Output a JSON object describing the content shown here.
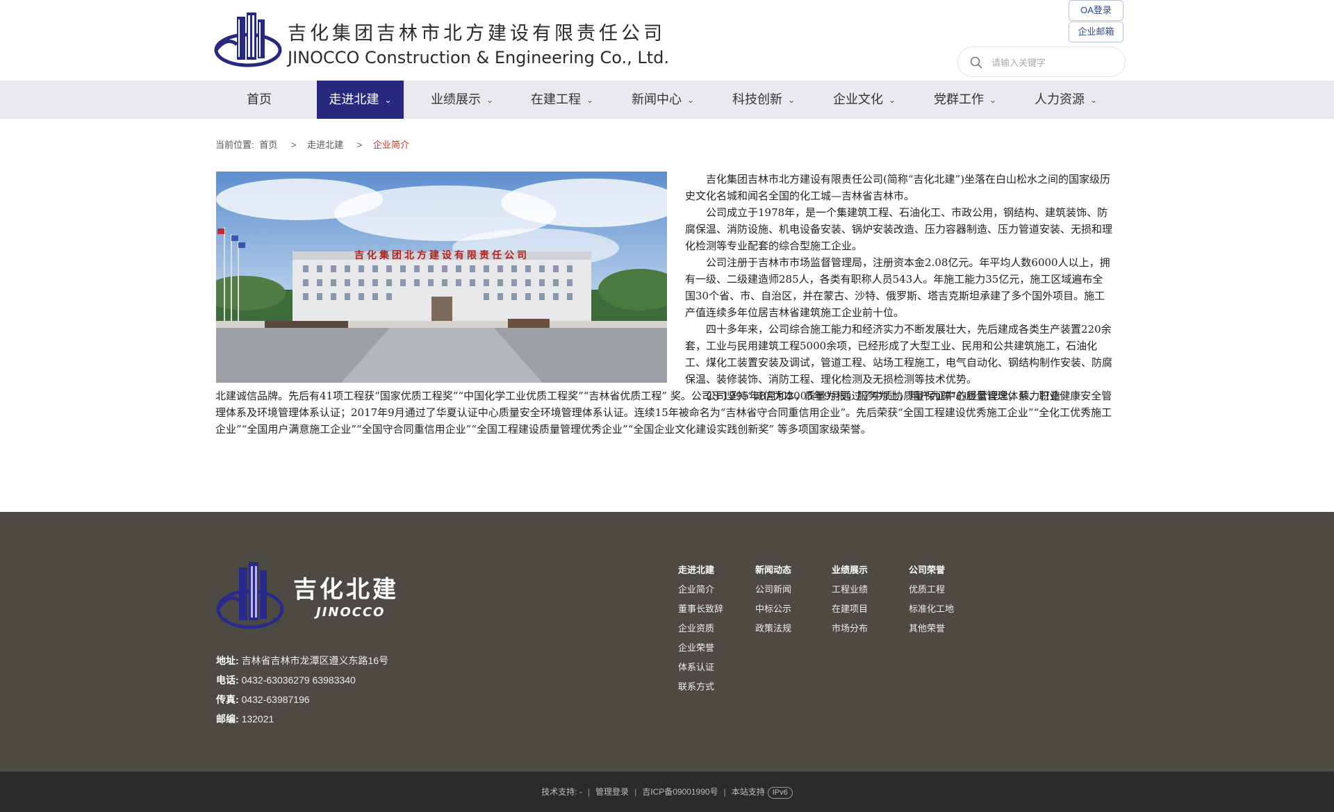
{
  "header": {
    "logo_cn": "吉化集团吉林市北方建设有限责任公司",
    "logo_en": "JINOCCO Construction & Engineering Co., Ltd.",
    "oa_login": "OA登录",
    "corp_mail": "企业邮箱",
    "search_placeholder": "请输入关键字"
  },
  "nav": {
    "items": [
      {
        "label": "首页",
        "has_menu": false
      },
      {
        "label": "走进北建",
        "has_menu": true,
        "active": true
      },
      {
        "label": "业绩展示",
        "has_menu": true
      },
      {
        "label": "在建工程",
        "has_menu": true
      },
      {
        "label": "新闻中心",
        "has_menu": true
      },
      {
        "label": "科技创新",
        "has_menu": true
      },
      {
        "label": "企业文化",
        "has_menu": true
      },
      {
        "label": "党群工作",
        "has_menu": true
      },
      {
        "label": "人力资源",
        "has_menu": true
      }
    ],
    "chevron_icon": "chevron-down-icon",
    "active_color": "#27297e"
  },
  "breadcrumb": {
    "prefix": "当前位置:",
    "home": "首页",
    "section": "走进北建",
    "current": "企业简介",
    "separator": ">"
  },
  "content": {
    "photo_sign": "吉化集团北方建设有限责任公司",
    "paragraphs_right": [
      "吉化集团吉林市北方建设有限责任公司(简称“吉化北建”)坐落在白山松水之间的国家级历史文化名城和闻名全国的化工城—吉林省吉林市。",
      "公司成立于1978年，是一个集建筑工程、石油化工、市政公用，钢结构、建筑装饰、防腐保温、消防设施、机电设备安装、锅炉安装改造、压力容器制造、压力管道安装、无损和理化检测等专业配套的综合型施工企业。",
      "公司注册于吉林市市场监督管理局，注册资本金2.08亿元。年平均人数6000人以上，拥有一级、二级建造师285人，各类有职称人员543人。年施工能力35亿元，施工区域遍布全国30个省、市、自治区，并在蒙古、沙特、俄罗斯、塔吉克斯坦承建了多个国外项目。施工产值连续多年位居吉林省建筑施工企业前十位。",
      "四十多年来，公司综合施工能力和经济实力不断发展壮大，先后建成各类生产装置220余套，工业与民用建筑工程5000余项，已经形成了大型工业、民用和公共建筑施工，石油化工、煤化工装置安装及调试，管道工程、站场工程施工，电气自动化、钢结构制作安装、防腐保温、装修装饰、消防工程、理化检测及无损检测等技术优势。"
    ],
    "paragraph_full_lead": "公司坚持“诚信为本，质量为根，服务为上，用户为尊”的经营理念，倾力打造",
    "paragraph_full_rest": "北建诚信品牌。先后有41项工程获“国家优质工程奖”“中国化学工业优质工程奖”“吉林省优质工程” 奖。公司于1995年8月和2005年9月通过了中质协质量保证中心质量管理体系、职业健康安全管理体系及环境管理体系认证；2017年9月通过了华夏认证中心质量安全环境管理体系认证。连续15年被命名为“吉林省守合同重信用企业”。先后荣获“全国工程建设优秀施工企业”“全化工优秀施工企业”“全国用户满意施工企业”“全国守合同重信用企业”“全国工程建设质量管理优秀企业”“全国企业文化建设实践创新奖” 等多项国家级荣誉。"
  },
  "footer": {
    "logo_cn": "吉化北建",
    "logo_en": "JINOCCO",
    "contact": [
      {
        "label": "地址:",
        "value": "吉林省吉林市龙潭区遵义东路16号"
      },
      {
        "label": "电话:",
        "value": "0432-63036279 63983340"
      },
      {
        "label": "传真:",
        "value": "0432-63987196"
      },
      {
        "label": "邮编:",
        "value": "132021"
      }
    ],
    "columns": [
      {
        "head": "走进北建",
        "links": [
          "企业简介",
          "董事长致辞",
          "企业资质",
          "企业荣誉",
          "体系认证",
          "联系方式"
        ]
      },
      {
        "head": "新闻动态",
        "links": [
          "公司新闻",
          "中标公示",
          "政策法规"
        ]
      },
      {
        "head": "业绩展示",
        "links": [
          "工程业绩",
          "在建项目",
          "市场分布"
        ]
      },
      {
        "head": "公司荣誉",
        "links": [
          "优质工程",
          "标准化工地",
          "其他荣誉"
        ]
      }
    ],
    "bottom": {
      "tech_support": "技术支持: -",
      "admin_login": "管理登录",
      "icp": "吉ICP备09001990号",
      "site_support": "本站支持",
      "ipv6": "IPv6"
    },
    "background": "#4d4a44",
    "bottom_background": "#2b2b2b"
  }
}
